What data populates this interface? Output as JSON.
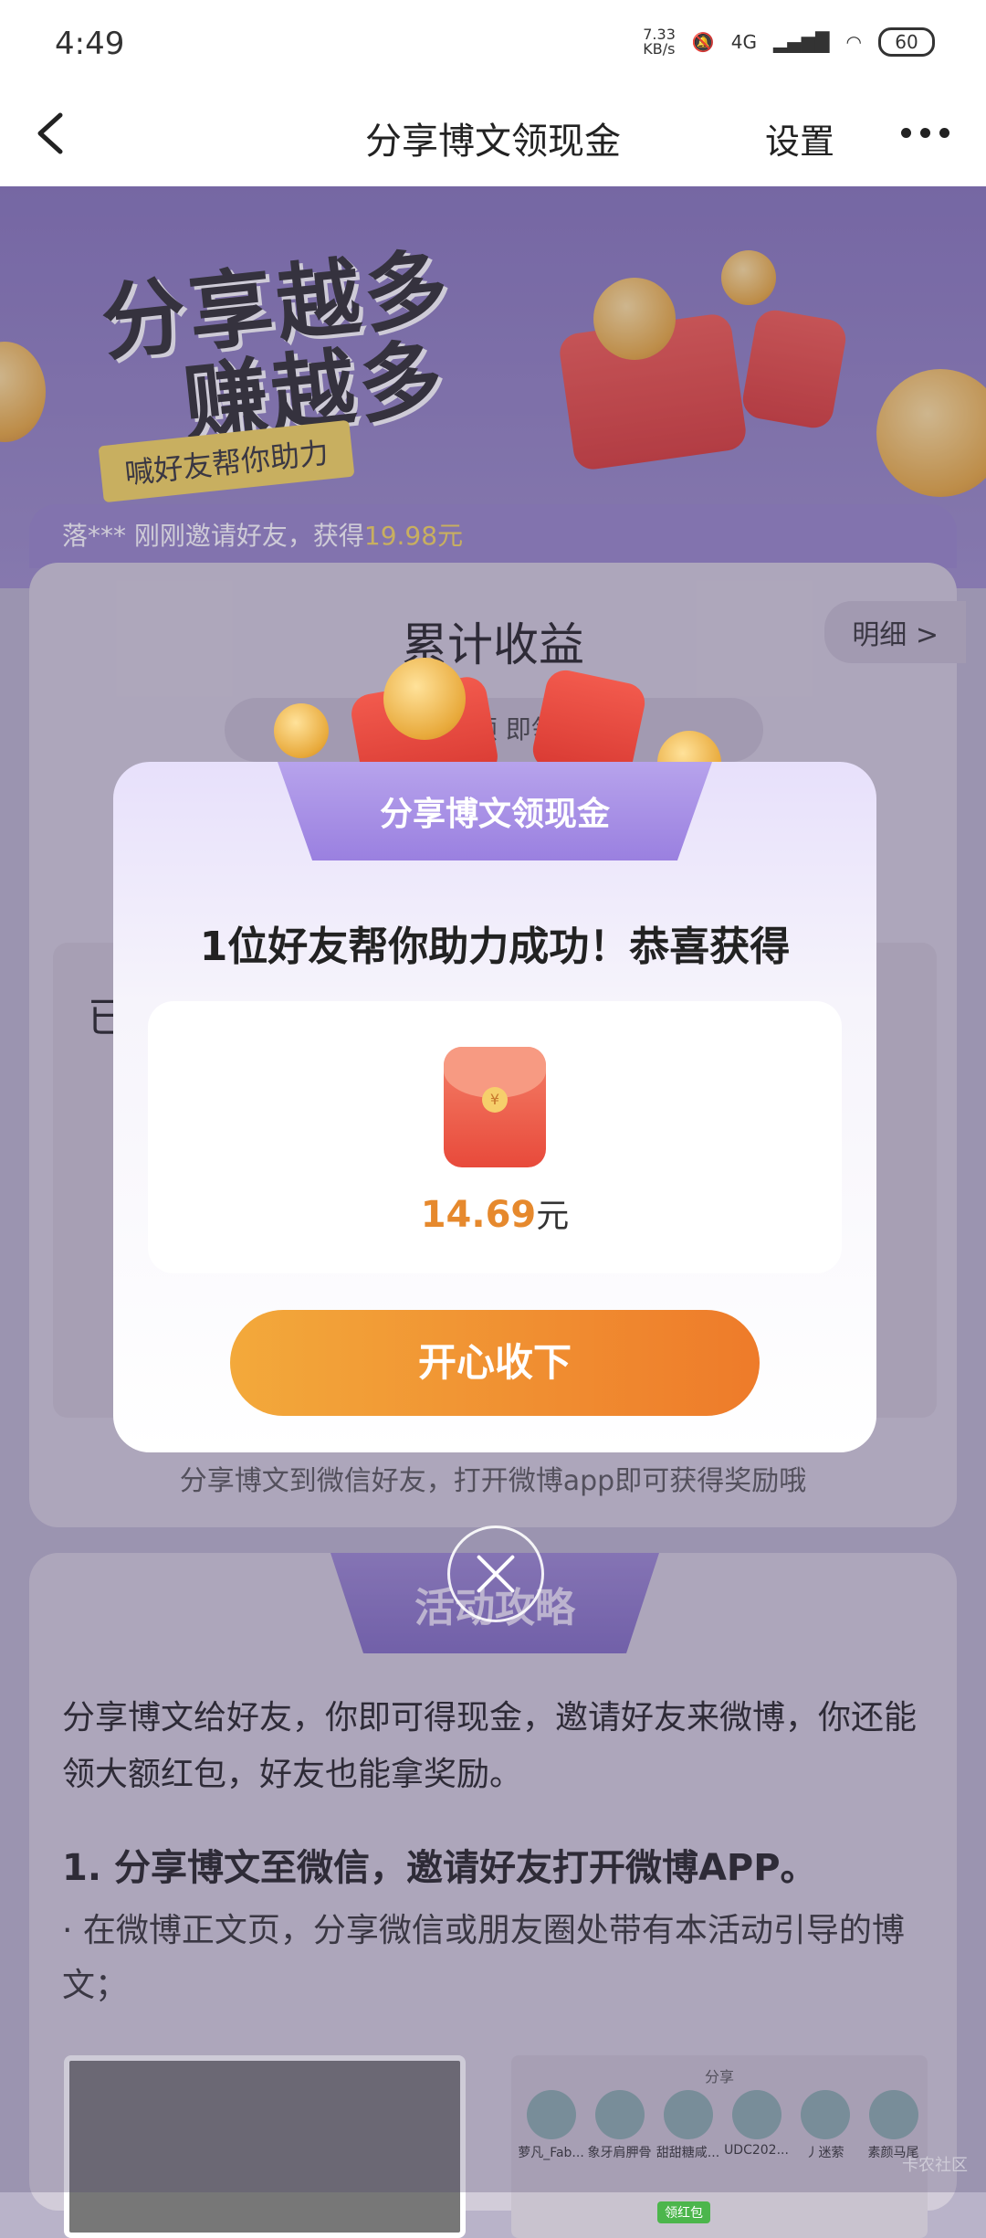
{
  "status_bar": {
    "time": "4:49",
    "net_speed": "7.33\nKB/s",
    "network": "4G",
    "battery": "60"
  },
  "nav": {
    "title": "分享博文领现金",
    "settings_label": "设置"
  },
  "banner": {
    "line1": "分享越多",
    "line2": "赚越多",
    "tag": "喊好友帮你助力"
  },
  "notice": {
    "prefix": "落*** 刚刚邀请好友，获得",
    "amount": "19.98元"
  },
  "earnings": {
    "title": "累计收益",
    "detail_label": "明细 >",
    "pill_text": "你 4. 领 即领取",
    "inner_text": "已",
    "share_tip": "分享博文到微信好友，打开微博app即可获得奖励哦"
  },
  "modal": {
    "tab_label": "分享博文领现金",
    "message": "1位好友帮你助力成功！恭喜获得",
    "amount": "14.69",
    "unit": "元",
    "accept_label": "开心收下"
  },
  "strategy": {
    "tab_label": "活动攻略",
    "intro": "分享博文给好友，你即可得现金，邀请好友来微博，你还能领大额红包，好友也能拿奖励。",
    "step1_title": "1. 分享博文至微信，邀请好友打开微博APP。",
    "step1_body": "· 在微博正文页，分享微信或朋友圈处带有本活动引导的博文；",
    "share_sheet_title": "分享",
    "share_names": [
      "萝凡_Fab...",
      "象牙肩胛骨",
      "甜甜糖咸...",
      "UDC202...",
      "丿迷萦",
      "素颜马尾"
    ],
    "share_tag": "领红包"
  },
  "watermark": "卡农社区"
}
